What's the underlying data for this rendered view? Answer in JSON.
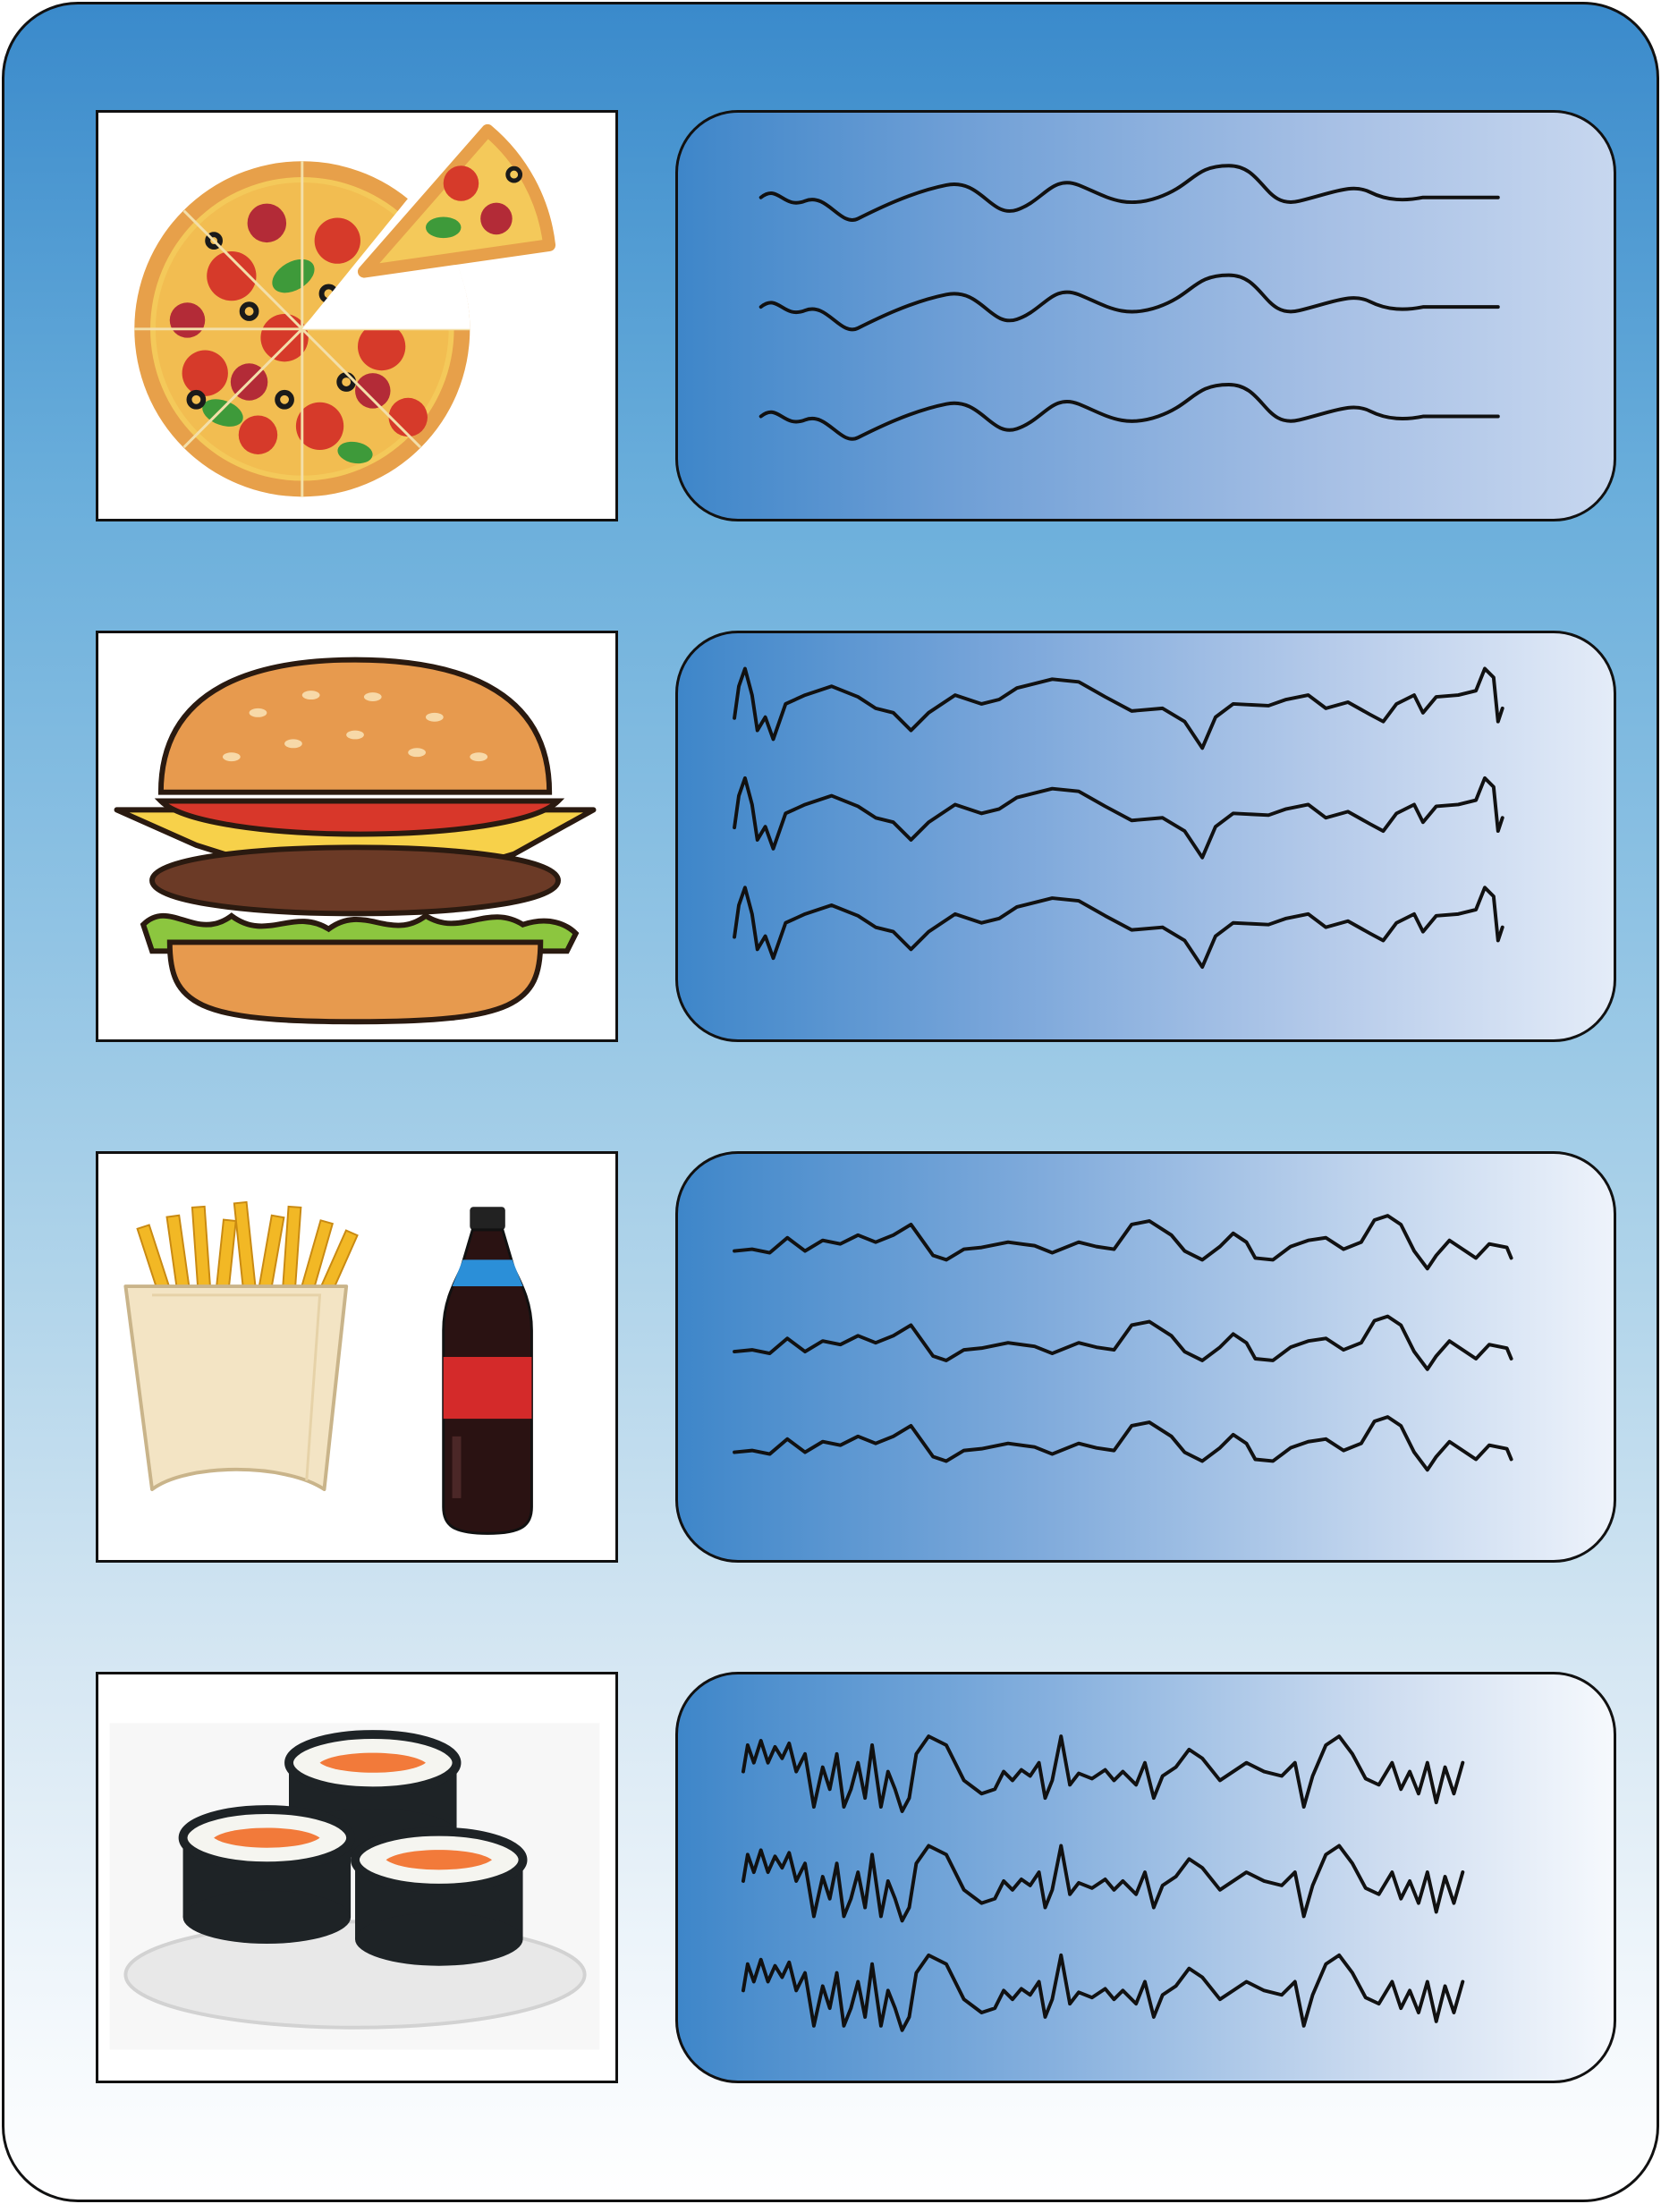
{
  "worksheet": {
    "rows": [
      {
        "picture": "pizza-picture",
        "line_style": "gentle-waves",
        "line_count": 3,
        "gradient": [
          "#3e86c9",
          "#dbe8f6"
        ]
      },
      {
        "picture": "burger-picture",
        "line_style": "waves-with-peaks",
        "line_count": 3,
        "gradient": [
          "#3e86c9",
          "#e9f0fa"
        ]
      },
      {
        "picture": "fries-and-soda-picture",
        "line_style": "bumpy-waves",
        "line_count": 3,
        "gradient": [
          "#3e86c9",
          "#eef3fb"
        ]
      },
      {
        "picture": "sushi-picture",
        "line_style": "jagged-zigzags",
        "line_count": 3,
        "gradient": [
          "#3e86c9",
          "#f6f9fd"
        ]
      }
    ]
  },
  "colors": {
    "sheet_top": "#3a8acb",
    "sheet_bottom": "#ffffff",
    "trace_line": "#111111"
  }
}
